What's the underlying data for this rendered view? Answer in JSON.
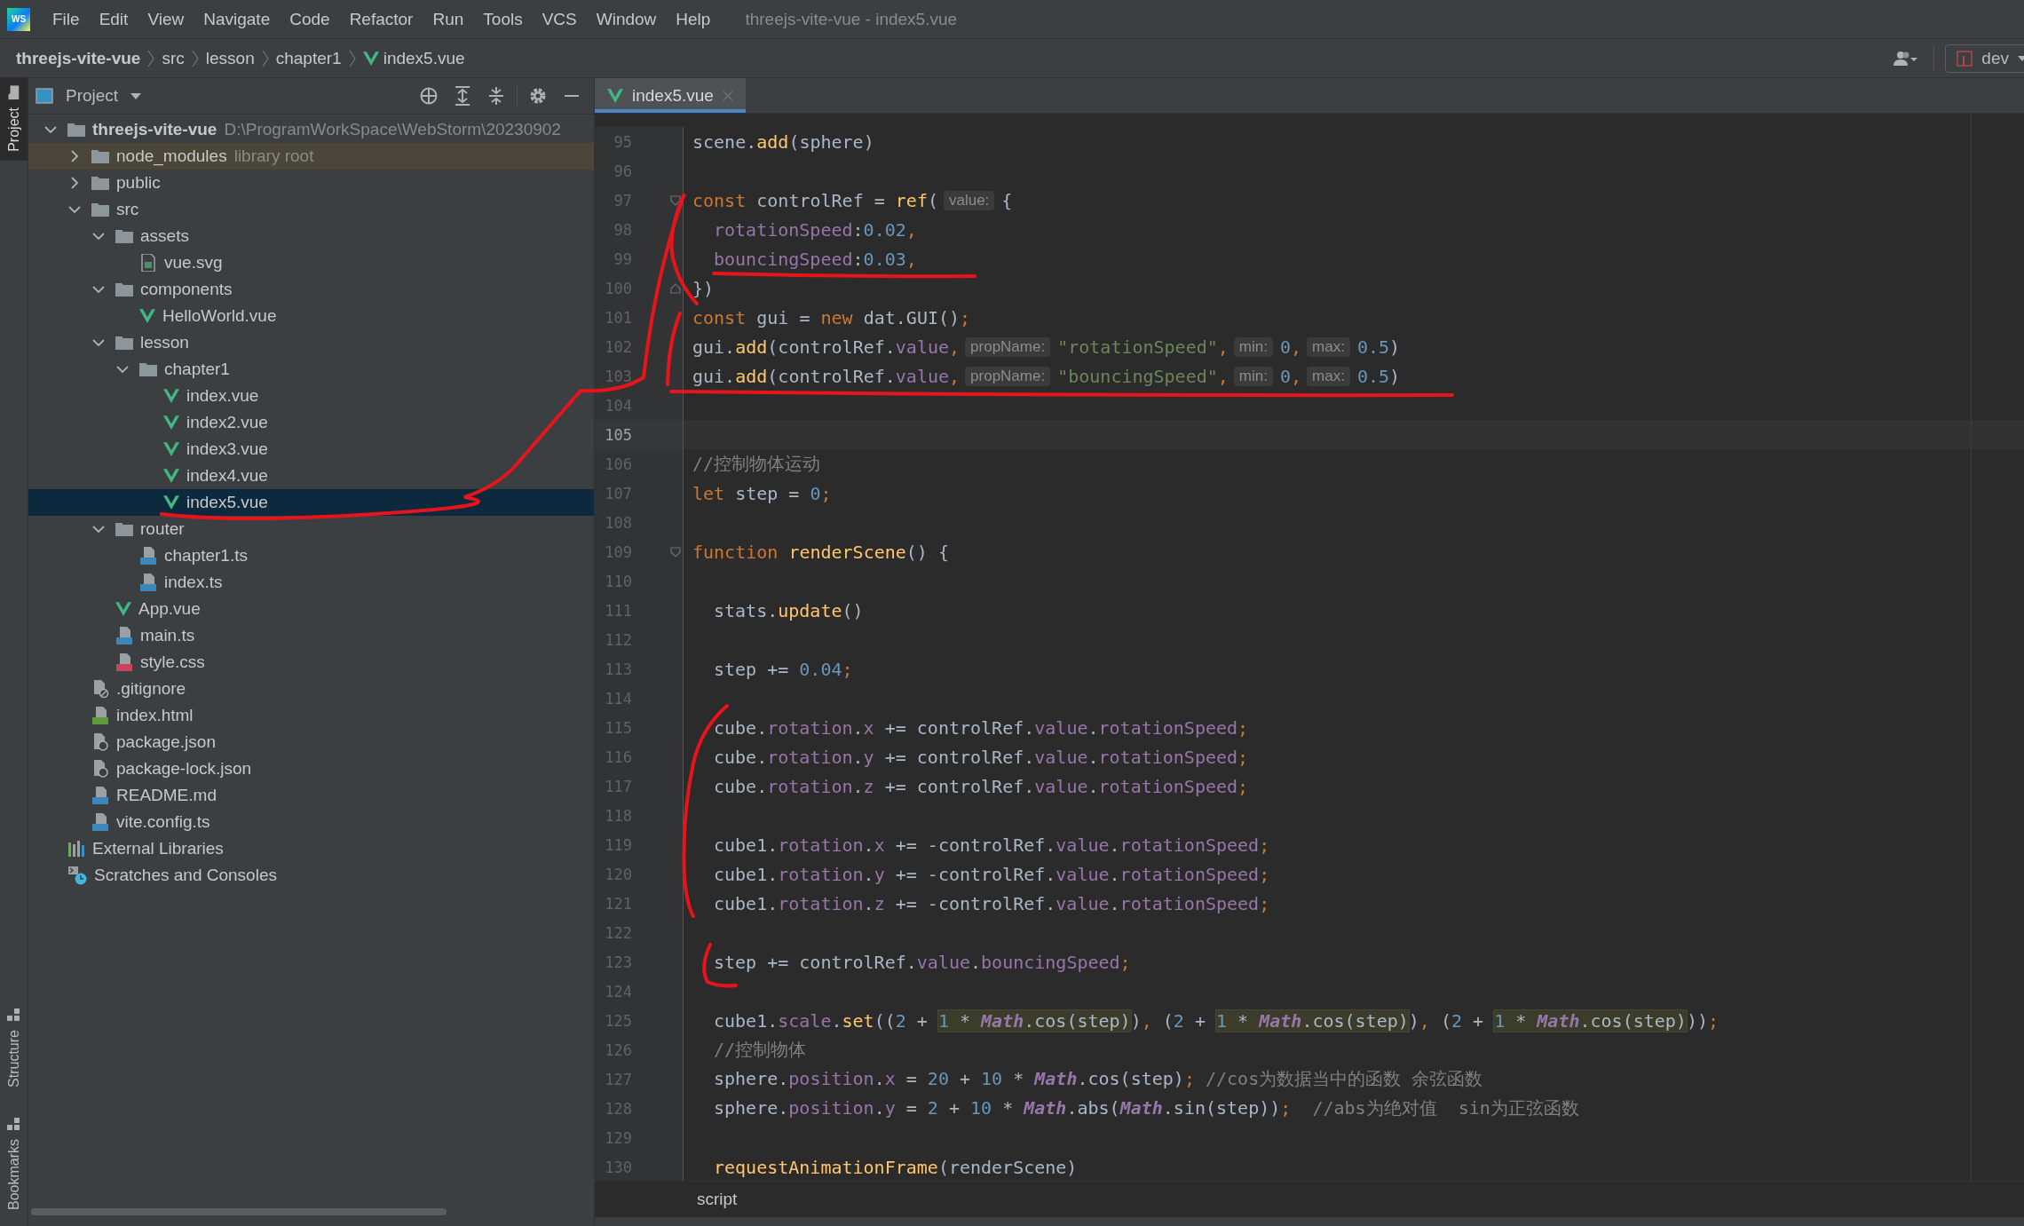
{
  "window": {
    "logo": "WS",
    "menu": [
      "File",
      "Edit",
      "View",
      "Navigate",
      "Code",
      "Refactor",
      "Run",
      "Tools",
      "VCS",
      "Window",
      "Help"
    ],
    "title": "threejs-vite-vue - index5.vue"
  },
  "breadcrumbs": [
    {
      "text": "threejs-vite-vue",
      "kind": "project"
    },
    {
      "text": "src",
      "kind": "folder"
    },
    {
      "text": "lesson",
      "kind": "folder"
    },
    {
      "text": "chapter1",
      "kind": "folder"
    },
    {
      "text": "index5.vue",
      "kind": "vue"
    }
  ],
  "branch": "dev",
  "tool_strip": [
    {
      "label": "Project",
      "selected": true
    },
    {
      "label": "Structure",
      "selected": false
    },
    {
      "label": "Bookmarks",
      "selected": false
    }
  ],
  "project": {
    "title": "Project",
    "tree": [
      {
        "name": "threejs-vite-vue",
        "kind": "root",
        "path": "D:\\ProgramWorkSpace\\WebStorm\\20230902",
        "expanded": true,
        "selected": false,
        "children": [
          {
            "name": "node_modules",
            "kind": "library",
            "hint": "library root",
            "expanded": false,
            "selected": false
          },
          {
            "name": "public",
            "kind": "folder",
            "expanded": false,
            "selected": false
          },
          {
            "name": "src",
            "kind": "folder",
            "expanded": true,
            "selected": false,
            "children": [
              {
                "name": "assets",
                "kind": "folder",
                "expanded": true,
                "selected": false,
                "children": [
                  {
                    "name": "vue.svg",
                    "kind": "image",
                    "selected": false
                  }
                ]
              },
              {
                "name": "components",
                "kind": "folder",
                "expanded": true,
                "selected": false,
                "children": [
                  {
                    "name": "HelloWorld.vue",
                    "kind": "vue",
                    "selected": false
                  }
                ]
              },
              {
                "name": "lesson",
                "kind": "folder",
                "expanded": true,
                "selected": false,
                "children": [
                  {
                    "name": "chapter1",
                    "kind": "folder",
                    "expanded": true,
                    "selected": false,
                    "children": [
                      {
                        "name": "index.vue",
                        "kind": "vue",
                        "selected": false
                      },
                      {
                        "name": "index2.vue",
                        "kind": "vue",
                        "selected": false
                      },
                      {
                        "name": "index3.vue",
                        "kind": "vue",
                        "selected": false
                      },
                      {
                        "name": "index4.vue",
                        "kind": "vue",
                        "selected": false
                      },
                      {
                        "name": "index5.vue",
                        "kind": "vue",
                        "selected": true
                      }
                    ]
                  }
                ]
              },
              {
                "name": "router",
                "kind": "folder",
                "expanded": true,
                "selected": false,
                "children": [
                  {
                    "name": "chapter1.ts",
                    "kind": "ts",
                    "selected": false
                  },
                  {
                    "name": "index.ts",
                    "kind": "ts",
                    "selected": false
                  }
                ]
              },
              {
                "name": "App.vue",
                "kind": "vue",
                "selected": false
              },
              {
                "name": "main.ts",
                "kind": "ts",
                "selected": false
              },
              {
                "name": "style.css",
                "kind": "css",
                "selected": false
              }
            ]
          },
          {
            "name": ".gitignore",
            "kind": "ignore",
            "selected": false
          },
          {
            "name": "index.html",
            "kind": "html",
            "selected": false
          },
          {
            "name": "package.json",
            "kind": "json",
            "selected": false
          },
          {
            "name": "package-lock.json",
            "kind": "json",
            "selected": false
          },
          {
            "name": "README.md",
            "kind": "md",
            "selected": false
          },
          {
            "name": "vite.config.ts",
            "kind": "ts",
            "selected": false
          }
        ]
      },
      {
        "name": "External Libraries",
        "kind": "libraries",
        "selected": false
      },
      {
        "name": "Scratches and Consoles",
        "kind": "scratches",
        "selected": false
      }
    ]
  },
  "editor": {
    "tabs": [
      {
        "label": "index5.vue",
        "selected": true
      }
    ],
    "lines": [
      {
        "number": "95",
        "kind": "code",
        "indented": false,
        "current": false,
        "segments": [
          {
            "kind": "code",
            "tokens": [
              {
                "text": "scene.",
                "kind": "plain"
              },
              {
                "text": "add",
                "kind": "fn"
              },
              {
                "text": "(sphere)",
                "kind": "plain"
              }
            ]
          }
        ]
      },
      {
        "number": "96",
        "kind": "code",
        "current": false
      },
      {
        "number": "97",
        "kind": "fold-start",
        "indented": false,
        "current": false,
        "segments": [
          {
            "kind": "code",
            "tokens": [
              {
                "text": "const",
                "kind": "kw"
              },
              {
                "text": " controlRef = ",
                "kind": "plain"
              },
              {
                "text": "ref",
                "kind": "fn"
              },
              {
                "text": "(",
                "kind": "plain"
              }
            ]
          },
          {
            "kind": "hint",
            "text": "value:"
          },
          {
            "kind": "code",
            "tokens": [
              {
                "text": "{",
                "kind": "plain"
              }
            ]
          }
        ]
      },
      {
        "number": "98",
        "kind": "code",
        "indented": true,
        "current": false,
        "segments": [
          {
            "kind": "code",
            "tokens": [
              {
                "text": "rotationSpeed",
                "kind": "field"
              },
              {
                "text": ":",
                "kind": "plain"
              },
              {
                "text": "0.02",
                "kind": "num"
              },
              {
                "text": ",",
                "kind": "punct"
              }
            ]
          }
        ]
      },
      {
        "number": "99",
        "kind": "code",
        "indented": true,
        "current": false,
        "segments": [
          {
            "kind": "code",
            "tokens": [
              {
                "text": "bouncingSpeed",
                "kind": "field"
              },
              {
                "text": ":",
                "kind": "plain"
              },
              {
                "text": "0.03",
                "kind": "num"
              },
              {
                "text": ",",
                "kind": "punct"
              }
            ]
          }
        ]
      },
      {
        "number": "100",
        "kind": "fold-end",
        "indented": false,
        "current": false,
        "segments": [
          {
            "kind": "code",
            "tokens": [
              {
                "text": "})",
                "kind": "plain"
              }
            ]
          }
        ]
      },
      {
        "number": "101",
        "kind": "code",
        "indented": false,
        "current": false,
        "segments": [
          {
            "kind": "code",
            "tokens": [
              {
                "text": "const",
                "kind": "kw"
              },
              {
                "text": " gui = ",
                "kind": "plain"
              },
              {
                "text": "new",
                "kind": "kw"
              },
              {
                "text": " dat.GUI()",
                "kind": "plain"
              },
              {
                "text": ";",
                "kind": "punct"
              }
            ]
          }
        ]
      },
      {
        "number": "102",
        "kind": "code",
        "indented": false,
        "current": false,
        "segments": [
          {
            "kind": "code",
            "tokens": [
              {
                "text": "gui.",
                "kind": "plain"
              },
              {
                "text": "add",
                "kind": "fn"
              },
              {
                "text": "(controlRef.",
                "kind": "plain"
              },
              {
                "text": "value",
                "kind": "field"
              },
              {
                "text": ",",
                "kind": "punct"
              }
            ]
          },
          {
            "kind": "hint",
            "text": "propName:"
          },
          {
            "kind": "code",
            "tokens": [
              {
                "text": "\"rotationSpeed\"",
                "kind": "str"
              },
              {
                "text": ",",
                "kind": "punct"
              }
            ]
          },
          {
            "kind": "hint",
            "text": "min:"
          },
          {
            "kind": "code",
            "tokens": [
              {
                "text": "0",
                "kind": "num"
              },
              {
                "text": ",",
                "kind": "punct"
              }
            ]
          },
          {
            "kind": "hint",
            "text": "max:"
          },
          {
            "kind": "code",
            "tokens": [
              {
                "text": "0.5",
                "kind": "num"
              },
              {
                "text": ")",
                "kind": "plain"
              }
            ]
          }
        ]
      },
      {
        "number": "103",
        "kind": "code",
        "indented": false,
        "current": false,
        "segments": [
          {
            "kind": "code",
            "tokens": [
              {
                "text": "gui.",
                "kind": "plain"
              },
              {
                "text": "add",
                "kind": "fn"
              },
              {
                "text": "(controlRef.",
                "kind": "plain"
              },
              {
                "text": "value",
                "kind": "field"
              },
              {
                "text": ",",
                "kind": "punct"
              }
            ]
          },
          {
            "kind": "hint",
            "text": "propName:"
          },
          {
            "kind": "code",
            "tokens": [
              {
                "text": "\"bouncingSpeed\"",
                "kind": "str"
              },
              {
                "text": ",",
                "kind": "punct"
              }
            ]
          },
          {
            "kind": "hint",
            "text": "min:"
          },
          {
            "kind": "code",
            "tokens": [
              {
                "text": "0",
                "kind": "num"
              },
              {
                "text": ",",
                "kind": "punct"
              }
            ]
          },
          {
            "kind": "hint",
            "text": "max:"
          },
          {
            "kind": "code",
            "tokens": [
              {
                "text": "0.5",
                "kind": "num"
              },
              {
                "text": ")",
                "kind": "plain"
              }
            ]
          }
        ]
      },
      {
        "number": "104",
        "kind": "code",
        "current": false
      },
      {
        "number": "105",
        "kind": "code",
        "current": true
      },
      {
        "number": "106",
        "kind": "code",
        "indented": false,
        "current": false,
        "segments": [
          {
            "kind": "code",
            "tokens": [
              {
                "text": "//控制物体运动",
                "kind": "comment"
              }
            ]
          }
        ]
      },
      {
        "number": "107",
        "kind": "code",
        "indented": false,
        "current": false,
        "segments": [
          {
            "kind": "code",
            "tokens": [
              {
                "text": "let",
                "kind": "kw"
              },
              {
                "text": " step = ",
                "kind": "plain"
              },
              {
                "text": "0",
                "kind": "num"
              },
              {
                "text": ";",
                "kind": "punct"
              }
            ]
          }
        ]
      },
      {
        "number": "108",
        "kind": "code",
        "current": false
      },
      {
        "number": "109",
        "kind": "fold-start",
        "indented": false,
        "current": false,
        "segments": [
          {
            "kind": "code",
            "tokens": [
              {
                "text": "function ",
                "kind": "kw"
              },
              {
                "text": "renderScene",
                "kind": "fn"
              },
              {
                "text": "() {",
                "kind": "plain"
              }
            ]
          }
        ]
      },
      {
        "number": "110",
        "kind": "code",
        "current": false
      },
      {
        "number": "111",
        "kind": "code",
        "indented": true,
        "current": false,
        "segments": [
          {
            "kind": "code",
            "tokens": [
              {
                "text": "stats.",
                "kind": "plain"
              },
              {
                "text": "update",
                "kind": "fn"
              },
              {
                "text": "()",
                "kind": "plain"
              }
            ]
          }
        ]
      },
      {
        "number": "112",
        "kind": "code",
        "current": false
      },
      {
        "number": "113",
        "kind": "code",
        "indented": true,
        "current": false,
        "segments": [
          {
            "kind": "code",
            "tokens": [
              {
                "text": "step += ",
                "kind": "plain"
              },
              {
                "text": "0.04",
                "kind": "num"
              },
              {
                "text": ";",
                "kind": "punct"
              }
            ]
          }
        ]
      },
      {
        "number": "114",
        "kind": "code",
        "current": false
      },
      {
        "number": "115",
        "kind": "code",
        "indented": true,
        "current": false,
        "segments": [
          {
            "kind": "code",
            "tokens": [
              {
                "text": "cube.",
                "kind": "plain"
              },
              {
                "text": "rotation",
                "kind": "field"
              },
              {
                "text": ".",
                "kind": "plain"
              },
              {
                "text": "x",
                "kind": "field"
              },
              {
                "text": " += controlRef.",
                "kind": "plain"
              },
              {
                "text": "value",
                "kind": "field"
              },
              {
                "text": ".",
                "kind": "plain"
              },
              {
                "text": "rotationSpeed",
                "kind": "field"
              },
              {
                "text": ";",
                "kind": "punct"
              }
            ]
          }
        ]
      },
      {
        "number": "116",
        "kind": "code",
        "indented": true,
        "current": false,
        "segments": [
          {
            "kind": "code",
            "tokens": [
              {
                "text": "cube.",
                "kind": "plain"
              },
              {
                "text": "rotation",
                "kind": "field"
              },
              {
                "text": ".",
                "kind": "plain"
              },
              {
                "text": "y",
                "kind": "field"
              },
              {
                "text": " += controlRef.",
                "kind": "plain"
              },
              {
                "text": "value",
                "kind": "field"
              },
              {
                "text": ".",
                "kind": "plain"
              },
              {
                "text": "rotationSpeed",
                "kind": "field"
              },
              {
                "text": ";",
                "kind": "punct"
              }
            ]
          }
        ]
      },
      {
        "number": "117",
        "kind": "code",
        "indented": true,
        "current": false,
        "segments": [
          {
            "kind": "code",
            "tokens": [
              {
                "text": "cube.",
                "kind": "plain"
              },
              {
                "text": "rotation",
                "kind": "field"
              },
              {
                "text": ".",
                "kind": "plain"
              },
              {
                "text": "z",
                "kind": "field"
              },
              {
                "text": " += controlRef.",
                "kind": "plain"
              },
              {
                "text": "value",
                "kind": "field"
              },
              {
                "text": ".",
                "kind": "plain"
              },
              {
                "text": "rotationSpeed",
                "kind": "field"
              },
              {
                "text": ";",
                "kind": "punct"
              }
            ]
          }
        ]
      },
      {
        "number": "118",
        "kind": "code",
        "current": false
      },
      {
        "number": "119",
        "kind": "code",
        "indented": true,
        "current": false,
        "segments": [
          {
            "kind": "code",
            "tokens": [
              {
                "text": "cube1.",
                "kind": "plain"
              },
              {
                "text": "rotation",
                "kind": "field"
              },
              {
                "text": ".",
                "kind": "plain"
              },
              {
                "text": "x",
                "kind": "field"
              },
              {
                "text": " += -controlRef.",
                "kind": "plain"
              },
              {
                "text": "value",
                "kind": "field"
              },
              {
                "text": ".",
                "kind": "plain"
              },
              {
                "text": "rotationSpeed",
                "kind": "field"
              },
              {
                "text": ";",
                "kind": "punct"
              }
            ]
          }
        ]
      },
      {
        "number": "120",
        "kind": "code",
        "indented": true,
        "current": false,
        "segments": [
          {
            "kind": "code",
            "tokens": [
              {
                "text": "cube1.",
                "kind": "plain"
              },
              {
                "text": "rotation",
                "kind": "field"
              },
              {
                "text": ".",
                "kind": "plain"
              },
              {
                "text": "y",
                "kind": "field"
              },
              {
                "text": " += -controlRef.",
                "kind": "plain"
              },
              {
                "text": "value",
                "kind": "field"
              },
              {
                "text": ".",
                "kind": "plain"
              },
              {
                "text": "rotationSpeed",
                "kind": "field"
              },
              {
                "text": ";",
                "kind": "punct"
              }
            ]
          }
        ]
      },
      {
        "number": "121",
        "kind": "code",
        "indented": true,
        "current": false,
        "segments": [
          {
            "kind": "code",
            "tokens": [
              {
                "text": "cube1.",
                "kind": "plain"
              },
              {
                "text": "rotation",
                "kind": "field"
              },
              {
                "text": ".",
                "kind": "plain"
              },
              {
                "text": "z",
                "kind": "field"
              },
              {
                "text": " += -controlRef.",
                "kind": "plain"
              },
              {
                "text": "value",
                "kind": "field"
              },
              {
                "text": ".",
                "kind": "plain"
              },
              {
                "text": "rotationSpeed",
                "kind": "field"
              },
              {
                "text": ";",
                "kind": "punct"
              }
            ]
          }
        ]
      },
      {
        "number": "122",
        "kind": "code",
        "current": false
      },
      {
        "number": "123",
        "kind": "code",
        "indented": true,
        "current": false,
        "segments": [
          {
            "kind": "code",
            "tokens": [
              {
                "text": "step += controlRef.",
                "kind": "plain"
              },
              {
                "text": "value",
                "kind": "field"
              },
              {
                "text": ".",
                "kind": "plain"
              },
              {
                "text": "bouncingSpeed",
                "kind": "field"
              },
              {
                "text": ";",
                "kind": "punct"
              }
            ]
          }
        ]
      },
      {
        "number": "124",
        "kind": "code",
        "current": false
      },
      {
        "number": "125",
        "kind": "code",
        "indented": true,
        "current": false,
        "segments": [
          {
            "kind": "code",
            "tokens": [
              {
                "text": "cube1.",
                "kind": "plain"
              },
              {
                "text": "scale",
                "kind": "field"
              },
              {
                "text": ".",
                "kind": "plain"
              },
              {
                "text": "set",
                "kind": "fn"
              },
              {
                "text": "((",
                "kind": "plain"
              },
              {
                "text": "2",
                "kind": "num"
              },
              {
                "text": " + ",
                "kind": "plain"
              }
            ]
          },
          {
            "kind": "highlight",
            "tokens": [
              {
                "text": "1",
                "kind": "num"
              },
              {
                "text": " * ",
                "kind": "plain"
              },
              {
                "text": "Math",
                "kind": "cls"
              },
              {
                "text": ".cos(step)",
                "kind": "plain"
              }
            ]
          },
          {
            "kind": "code",
            "tokens": [
              {
                "text": ")",
                "kind": "plain"
              },
              {
                "text": ",",
                "kind": "punct"
              },
              {
                "text": " (",
                "kind": "plain"
              },
              {
                "text": "2",
                "kind": "num"
              },
              {
                "text": " + ",
                "kind": "plain"
              }
            ]
          },
          {
            "kind": "highlight",
            "tokens": [
              {
                "text": "1",
                "kind": "num"
              },
              {
                "text": " * ",
                "kind": "plain"
              },
              {
                "text": "Math",
                "kind": "cls"
              },
              {
                "text": ".cos(step)",
                "kind": "plain"
              }
            ]
          },
          {
            "kind": "code",
            "tokens": [
              {
                "text": ")",
                "kind": "plain"
              },
              {
                "text": ",",
                "kind": "punct"
              },
              {
                "text": " (",
                "kind": "plain"
              },
              {
                "text": "2",
                "kind": "num"
              },
              {
                "text": " + ",
                "kind": "plain"
              }
            ]
          },
          {
            "kind": "highlight",
            "tokens": [
              {
                "text": "1",
                "kind": "num"
              },
              {
                "text": " * ",
                "kind": "plain"
              },
              {
                "text": "Math",
                "kind": "cls"
              },
              {
                "text": ".cos(step)",
                "kind": "plain"
              }
            ]
          },
          {
            "kind": "code",
            "tokens": [
              {
                "text": "))",
                "kind": "plain"
              },
              {
                "text": ";",
                "kind": "punct"
              }
            ]
          }
        ]
      },
      {
        "number": "126",
        "kind": "code",
        "indented": true,
        "current": false,
        "segments": [
          {
            "kind": "code",
            "tokens": [
              {
                "text": "//控制物体",
                "kind": "comment"
              }
            ]
          }
        ]
      },
      {
        "number": "127",
        "kind": "code",
        "indented": true,
        "current": false,
        "segments": [
          {
            "kind": "code",
            "tokens": [
              {
                "text": "sphere.",
                "kind": "plain"
              },
              {
                "text": "position",
                "kind": "field"
              },
              {
                "text": ".",
                "kind": "plain"
              },
              {
                "text": "x",
                "kind": "field"
              },
              {
                "text": " = ",
                "kind": "plain"
              },
              {
                "text": "20",
                "kind": "num"
              },
              {
                "text": " + ",
                "kind": "plain"
              },
              {
                "text": "10",
                "kind": "num"
              },
              {
                "text": " * ",
                "kind": "plain"
              },
              {
                "text": "Math",
                "kind": "cls"
              },
              {
                "text": ".cos(step)",
                "kind": "plain"
              },
              {
                "text": "; ",
                "kind": "punct"
              },
              {
                "text": "//cos为数据当中的函数 余弦函数",
                "kind": "comment"
              }
            ]
          }
        ]
      },
      {
        "number": "128",
        "kind": "code",
        "indented": true,
        "current": false,
        "segments": [
          {
            "kind": "code",
            "tokens": [
              {
                "text": "sphere.",
                "kind": "plain"
              },
              {
                "text": "position",
                "kind": "field"
              },
              {
                "text": ".",
                "kind": "plain"
              },
              {
                "text": "y",
                "kind": "field"
              },
              {
                "text": " = ",
                "kind": "plain"
              },
              {
                "text": "2",
                "kind": "num"
              },
              {
                "text": " + ",
                "kind": "plain"
              },
              {
                "text": "10",
                "kind": "num"
              },
              {
                "text": " * ",
                "kind": "plain"
              },
              {
                "text": "Math",
                "kind": "cls"
              },
              {
                "text": ".abs(",
                "kind": "plain"
              },
              {
                "text": "Math",
                "kind": "cls"
              },
              {
                "text": ".sin(step))",
                "kind": "plain"
              },
              {
                "text": ";  ",
                "kind": "punct"
              },
              {
                "text": "//abs为绝对值  sin为正弦函数",
                "kind": "comment"
              }
            ]
          }
        ]
      },
      {
        "number": "129",
        "kind": "code",
        "current": false
      },
      {
        "number": "130",
        "kind": "code",
        "indented": true,
        "current": false,
        "segments": [
          {
            "kind": "code",
            "tokens": [
              {
                "text": "requestAnimationFrame",
                "kind": "fn"
              },
              {
                "text": "(renderScene)",
                "kind": "plain"
              }
            ]
          }
        ]
      }
    ],
    "breadcrumb": "script"
  }
}
